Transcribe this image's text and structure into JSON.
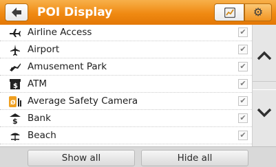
{
  "header": {
    "title": "POI Display",
    "back_icon": "back-arrow-icon",
    "map_icon": "map-icon",
    "gear_icon": "gear-icon",
    "gear_glyph": "⚙"
  },
  "poi_list": [
    {
      "label": "Airline Access",
      "icon": "airline-icon",
      "checked": true
    },
    {
      "label": "Airport",
      "icon": "airplane-icon",
      "checked": true
    },
    {
      "label": "Amusement Park",
      "icon": "amusement-park-icon",
      "checked": true
    },
    {
      "label": "ATM",
      "icon": "atm-icon",
      "checked": true
    },
    {
      "label": "Average Safety Camera",
      "icon": "safety-camera-icon",
      "checked": true
    },
    {
      "label": "Bank",
      "icon": "bank-icon",
      "checked": true
    },
    {
      "label": "Beach",
      "icon": "beach-icon",
      "checked": true
    }
  ],
  "scroll": {
    "up_icon": "chevron-up-icon",
    "down_icon": "chevron-down-icon"
  },
  "footer": {
    "show_all": "Show all",
    "hide_all": "Hide all"
  },
  "colors": {
    "header_orange": "#f08a12",
    "background": "#ffffff"
  }
}
